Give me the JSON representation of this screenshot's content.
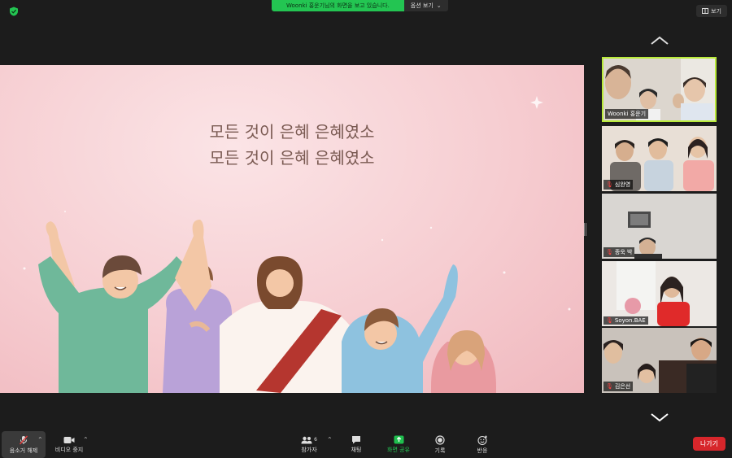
{
  "top": {
    "share_banner": "Woonki 홍운기님의 화면을 보고 있습니다.",
    "view_options": "옵션 보기",
    "view_button": "보기"
  },
  "slide": {
    "line1": "모든 것이 은혜 은혜였소",
    "line2": "모든 것이 은혜 은혜였소"
  },
  "participants": [
    {
      "name": "Woonki 홍운기",
      "active": true,
      "muted": false
    },
    {
      "name": "심완영",
      "active": false,
      "muted": true
    },
    {
      "name": "종욱 박",
      "active": false,
      "muted": true
    },
    {
      "name": "Soyon.BAE",
      "active": false,
      "muted": true
    },
    {
      "name": "김은선",
      "active": false,
      "muted": true
    }
  ],
  "toolbar": {
    "unmute": "음소거 해제",
    "video_stop": "비디오 중지",
    "participants": "참가자",
    "participants_count": "6",
    "chat": "채팅",
    "share_screen": "화면 공유",
    "record": "기록",
    "reactions": "반응",
    "leave": "나가기"
  },
  "colors": {
    "share_banner_green": "#23c552",
    "active_speaker_border": "#b9ea3a",
    "leave_red": "#d7262b",
    "share_icon_green": "#1fbf4e"
  }
}
